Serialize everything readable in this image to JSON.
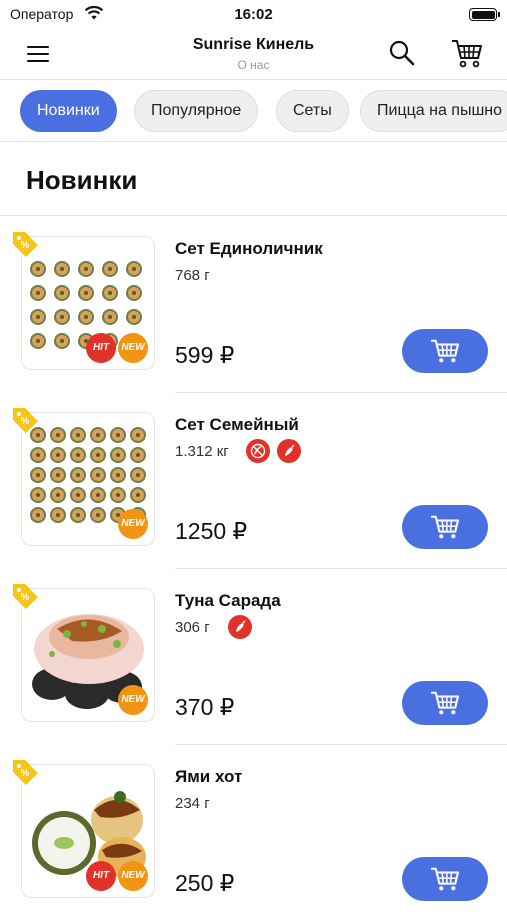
{
  "status_bar": {
    "carrier": "Оператор",
    "time": "16:02"
  },
  "header": {
    "title": "Sunrise Кинель",
    "subtitle": "О нас",
    "menu_icon": "hamburger-icon",
    "search_icon": "search-icon",
    "cart_icon": "cart-icon"
  },
  "tabs": [
    {
      "label": "Новинки",
      "active": true
    },
    {
      "label": "Популярное",
      "active": false
    },
    {
      "label": "Сеты",
      "active": false
    },
    {
      "label": "Пицца на пышно",
      "active": false
    }
  ],
  "section_title": "Новинки",
  "items": [
    {
      "name": "Сет Единоличник",
      "weight": "768 г",
      "price": "599 ₽",
      "badges": [
        "HIT",
        "NEW"
      ],
      "properties": []
    },
    {
      "name": "Сет Семейный",
      "weight": "1.312 кг",
      "price": "1250 ₽",
      "badges": [
        "NEW"
      ],
      "properties": [
        "no-spicy-icon",
        "chili-icon"
      ]
    },
    {
      "name": "Туна Сарада",
      "weight": "306 г",
      "price": "370 ₽",
      "badges": [
        "NEW"
      ],
      "properties": [
        "chili-icon"
      ]
    },
    {
      "name": "Ями хот",
      "weight": "234 г",
      "price": "250 ₽",
      "badges": [
        "HIT",
        "NEW"
      ],
      "properties": []
    }
  ],
  "colors": {
    "accent": "#4a6fe0",
    "hit": "#e03228",
    "new": "#f39314",
    "tag": "#f5c518"
  }
}
